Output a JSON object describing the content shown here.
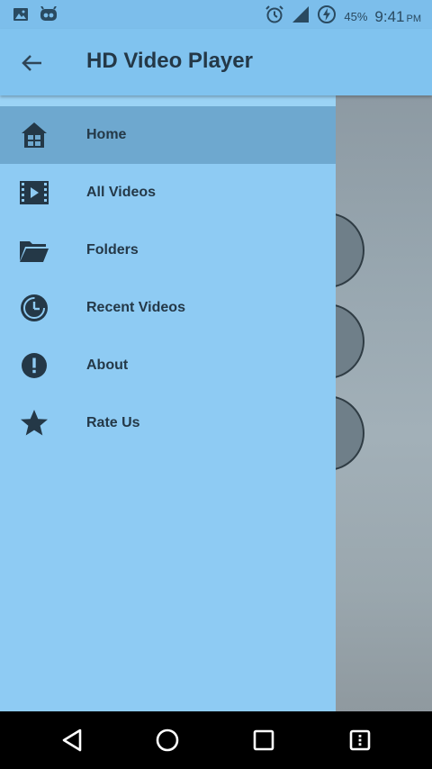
{
  "status_bar": {
    "battery_percent": "45%",
    "time": "9:41",
    "am_pm": "PM",
    "icons": [
      "image-icon",
      "cyanogen-icon",
      "alarm-icon",
      "signal-icon",
      "battery-charging-icon"
    ]
  },
  "app_bar": {
    "title": "HD Video Player",
    "back_icon": "arrow-back-icon"
  },
  "drawer": {
    "items": [
      {
        "label": "Home",
        "icon": "home-icon",
        "selected": true
      },
      {
        "label": "All Videos",
        "icon": "film-icon",
        "selected": false
      },
      {
        "label": "Folders",
        "icon": "folder-icon",
        "selected": false
      },
      {
        "label": "Recent Videos",
        "icon": "history-icon",
        "selected": false
      },
      {
        "label": "About",
        "icon": "info-alert-icon",
        "selected": false
      },
      {
        "label": "Rate Us",
        "icon": "star-icon",
        "selected": false
      }
    ]
  },
  "colors": {
    "app_bar": "#80c3ef",
    "drawer": "#8ecbf3",
    "selected_item": "#6ea8cf",
    "text": "#243847"
  },
  "nav_bar": {
    "icons": [
      "back-triangle-icon",
      "home-circle-icon",
      "recents-square-icon",
      "menu-icon"
    ]
  }
}
